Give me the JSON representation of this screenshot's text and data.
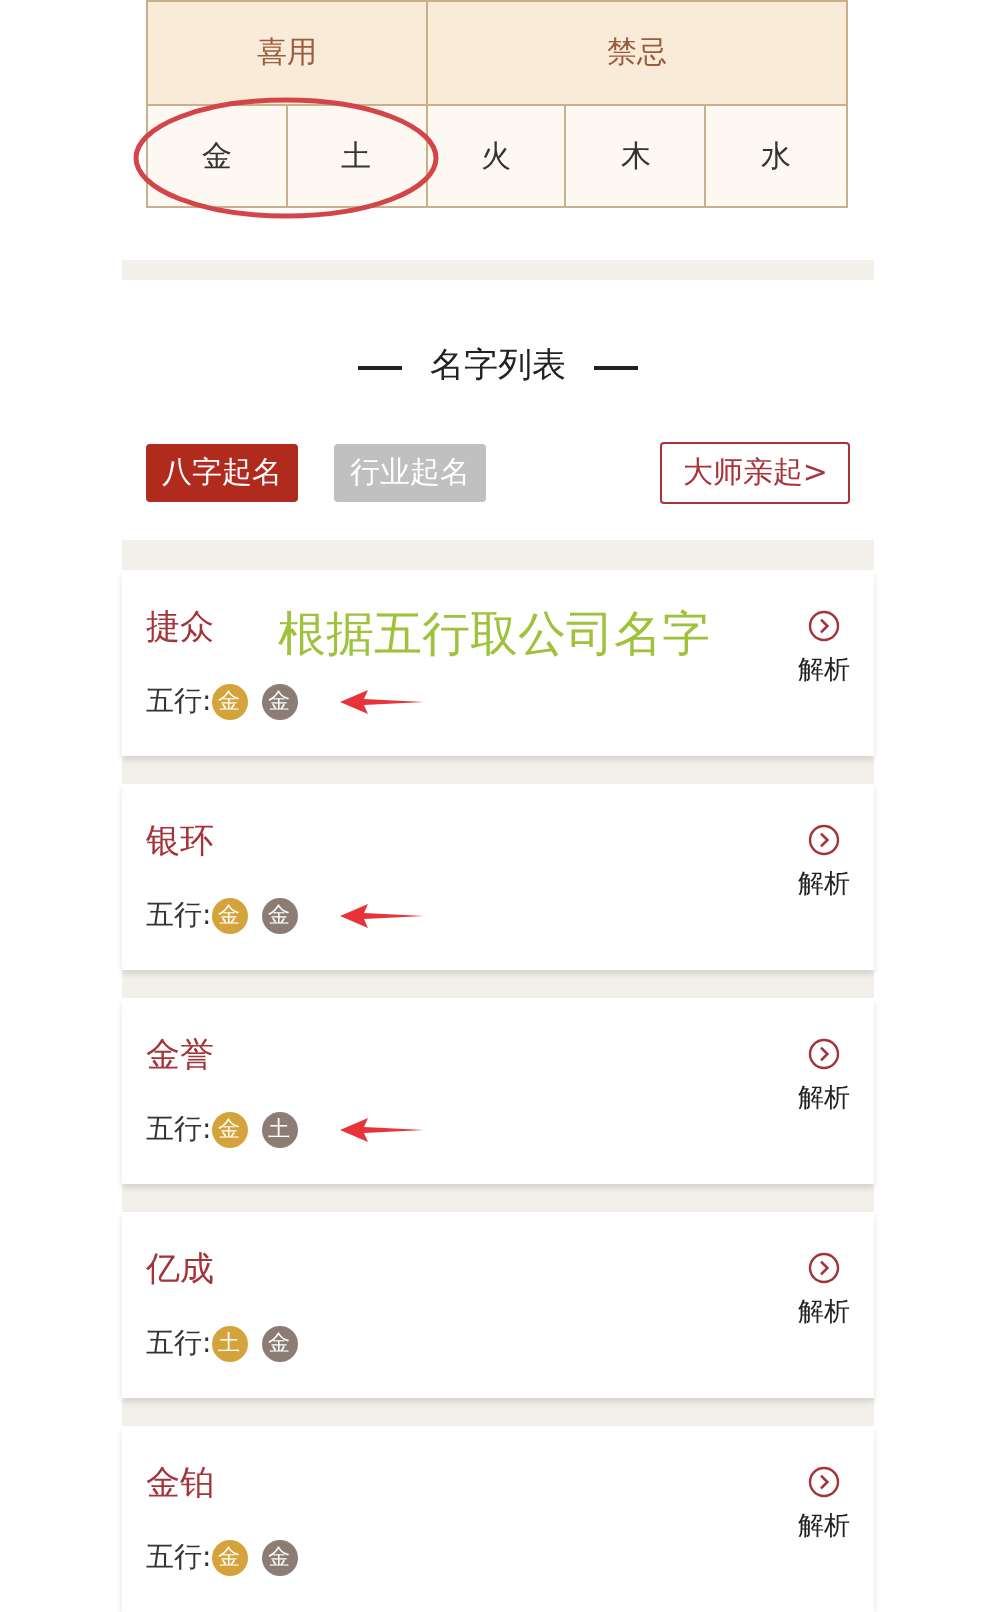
{
  "wuxing_table": {
    "favorable": {
      "label": "喜用",
      "elements": [
        "金",
        "土"
      ],
      "circled": true
    },
    "taboo": {
      "label": "禁忌",
      "elements": [
        "火",
        "木",
        "水"
      ]
    }
  },
  "name_list": {
    "title": "名字列表",
    "tabs": [
      {
        "label": "八字起名",
        "selected": true
      },
      {
        "label": "行业起名",
        "selected": false
      }
    ],
    "master_link": "大师亲起>",
    "names": [
      {
        "name": "捷众",
        "wuxing_label": "五行:",
        "elements": [
          {
            "char": "金",
            "color": "#d4a33c"
          },
          {
            "char": "金",
            "color": "#8c7d74"
          }
        ],
        "action": "解析",
        "arrow": true
      },
      {
        "name": "银环",
        "wuxing_label": "五行:",
        "elements": [
          {
            "char": "金",
            "color": "#d4a33c"
          },
          {
            "char": "金",
            "color": "#8c7d74"
          }
        ],
        "action": "解析",
        "arrow": true
      },
      {
        "name": "金誉",
        "wuxing_label": "五行:",
        "elements": [
          {
            "char": "金",
            "color": "#d4a33c"
          },
          {
            "char": "土",
            "color": "#8c7d74"
          }
        ],
        "action": "解析",
        "arrow": true
      },
      {
        "name": "亿成",
        "wuxing_label": "五行:",
        "elements": [
          {
            "char": "土",
            "color": "#d4a33c"
          },
          {
            "char": "金",
            "color": "#8c7d74"
          }
        ],
        "action": "解析",
        "arrow": false
      },
      {
        "name": "金铂",
        "wuxing_label": "五行:",
        "elements": [
          {
            "char": "金",
            "color": "#d4a33c"
          },
          {
            "char": "金",
            "color": "#8c7d74"
          }
        ],
        "action": "解析",
        "arrow": false
      }
    ]
  },
  "annotation_text": "根据五行取公司名字"
}
